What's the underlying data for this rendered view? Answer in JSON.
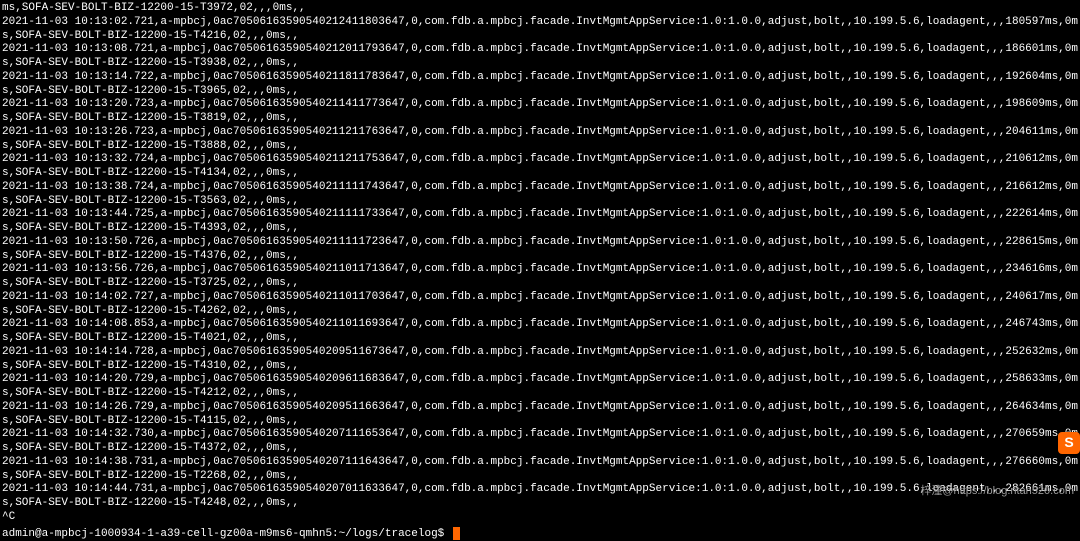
{
  "logs": [
    "ms,SOFA-SEV-BOLT-BIZ-12200-15-T3972,02,,,0ms,,",
    "2021-11-03 10:13:02.721,a-mpbcj,0ac70506163590540212411803647,0,com.fdb.a.mpbcj.facade.InvtMgmtAppService:1.0:1.0.0,adjust,bolt,,10.199.5.6,loadagent,,,180597ms,0ms,SOFA-SEV-BOLT-BIZ-12200-15-T4216,02,,,0ms,,",
    "2021-11-03 10:13:08.721,a-mpbcj,0ac70506163590540212011793647,0,com.fdb.a.mpbcj.facade.InvtMgmtAppService:1.0:1.0.0,adjust,bolt,,10.199.5.6,loadagent,,,186601ms,0ms,SOFA-SEV-BOLT-BIZ-12200-15-T3938,02,,,0ms,,",
    "2021-11-03 10:13:14.722,a-mpbcj,0ac70506163590540211811783647,0,com.fdb.a.mpbcj.facade.InvtMgmtAppService:1.0:1.0.0,adjust,bolt,,10.199.5.6,loadagent,,,192604ms,0ms,SOFA-SEV-BOLT-BIZ-12200-15-T3965,02,,,0ms,,",
    "2021-11-03 10:13:20.723,a-mpbcj,0ac70506163590540211411773647,0,com.fdb.a.mpbcj.facade.InvtMgmtAppService:1.0:1.0.0,adjust,bolt,,10.199.5.6,loadagent,,,198609ms,0ms,SOFA-SEV-BOLT-BIZ-12200-15-T3819,02,,,0ms,,",
    "2021-11-03 10:13:26.723,a-mpbcj,0ac70506163590540211211763647,0,com.fdb.a.mpbcj.facade.InvtMgmtAppService:1.0:1.0.0,adjust,bolt,,10.199.5.6,loadagent,,,204611ms,0ms,SOFA-SEV-BOLT-BIZ-12200-15-T3888,02,,,0ms,,",
    "2021-11-03 10:13:32.724,a-mpbcj,0ac70506163590540211211753647,0,com.fdb.a.mpbcj.facade.InvtMgmtAppService:1.0:1.0.0,adjust,bolt,,10.199.5.6,loadagent,,,210612ms,0ms,SOFA-SEV-BOLT-BIZ-12200-15-T4134,02,,,0ms,,",
    "2021-11-03 10:13:38.724,a-mpbcj,0ac70506163590540211111743647,0,com.fdb.a.mpbcj.facade.InvtMgmtAppService:1.0:1.0.0,adjust,bolt,,10.199.5.6,loadagent,,,216612ms,0ms,SOFA-SEV-BOLT-BIZ-12200-15-T3563,02,,,0ms,,",
    "2021-11-03 10:13:44.725,a-mpbcj,0ac70506163590540211111733647,0,com.fdb.a.mpbcj.facade.InvtMgmtAppService:1.0:1.0.0,adjust,bolt,,10.199.5.6,loadagent,,,222614ms,0ms,SOFA-SEV-BOLT-BIZ-12200-15-T4393,02,,,0ms,,",
    "2021-11-03 10:13:50.726,a-mpbcj,0ac70506163590540211111723647,0,com.fdb.a.mpbcj.facade.InvtMgmtAppService:1.0:1.0.0,adjust,bolt,,10.199.5.6,loadagent,,,228615ms,0ms,SOFA-SEV-BOLT-BIZ-12200-15-T4376,02,,,0ms,,",
    "2021-11-03 10:13:56.726,a-mpbcj,0ac70506163590540211011713647,0,com.fdb.a.mpbcj.facade.InvtMgmtAppService:1.0:1.0.0,adjust,bolt,,10.199.5.6,loadagent,,,234616ms,0ms,SOFA-SEV-BOLT-BIZ-12200-15-T3725,02,,,0ms,,",
    "2021-11-03 10:14:02.727,a-mpbcj,0ac70506163590540211011703647,0,com.fdb.a.mpbcj.facade.InvtMgmtAppService:1.0:1.0.0,adjust,bolt,,10.199.5.6,loadagent,,,240617ms,0ms,SOFA-SEV-BOLT-BIZ-12200-15-T4262,02,,,0ms,,",
    "2021-11-03 10:14:08.853,a-mpbcj,0ac70506163590540211011693647,0,com.fdb.a.mpbcj.facade.InvtMgmtAppService:1.0:1.0.0,adjust,bolt,,10.199.5.6,loadagent,,,246743ms,0ms,SOFA-SEV-BOLT-BIZ-12200-15-T4021,02,,,0ms,,",
    "2021-11-03 10:14:14.728,a-mpbcj,0ac70506163590540209511673647,0,com.fdb.a.mpbcj.facade.InvtMgmtAppService:1.0:1.0.0,adjust,bolt,,10.199.5.6,loadagent,,,252632ms,0ms,SOFA-SEV-BOLT-BIZ-12200-15-T4310,02,,,0ms,,",
    "2021-11-03 10:14:20.729,a-mpbcj,0ac70506163590540209611683647,0,com.fdb.a.mpbcj.facade.InvtMgmtAppService:1.0:1.0.0,adjust,bolt,,10.199.5.6,loadagent,,,258633ms,0ms,SOFA-SEV-BOLT-BIZ-12200-15-T4212,02,,,0ms,,",
    "2021-11-03 10:14:26.729,a-mpbcj,0ac70506163590540209511663647,0,com.fdb.a.mpbcj.facade.InvtMgmtAppService:1.0:1.0.0,adjust,bolt,,10.199.5.6,loadagent,,,264634ms,0ms,SOFA-SEV-BOLT-BIZ-12200-15-T4115,02,,,0ms,,",
    "2021-11-03 10:14:32.730,a-mpbcj,0ac70506163590540207111653647,0,com.fdb.a.mpbcj.facade.InvtMgmtAppService:1.0:1.0.0,adjust,bolt,,10.199.5.6,loadagent,,,270659ms,0ms,SOFA-SEV-BOLT-BIZ-12200-15-T4372,02,,,0ms,,",
    "2021-11-03 10:14:38.731,a-mpbcj,0ac70506163590540207111643647,0,com.fdb.a.mpbcj.facade.InvtMgmtAppService:1.0:1.0.0,adjust,bolt,,10.199.5.6,loadagent,,,276660ms,0ms,SOFA-SEV-BOLT-BIZ-12200-15-T2268,02,,,0ms,,",
    "2021-11-03 10:14:44.731,a-mpbcj,0ac70506163590540207011633647,0,com.fdb.a.mpbcj.facade.InvtMgmtAppService:1.0:1.0.0,adjust,bolt,,10.199.5.6,loadagent,,,282661ms,0ms,SOFA-SEV-BOLT-BIZ-12200-15-T4248,02,,,0ms,,",
    "^C"
  ],
  "prompt": "admin@a-mpbcj-1000934-1-a39-cell-gz00a-m9ms6-qmhn5:~/logs/tracelog$",
  "watermark": "梓潼@https://blog.ntan520.com",
  "badge": "S"
}
